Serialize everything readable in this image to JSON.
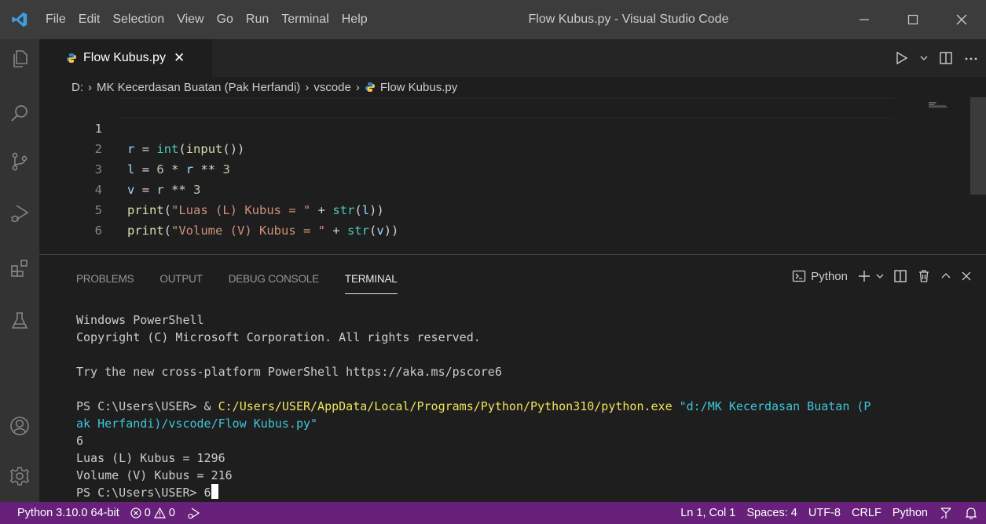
{
  "titlebar": {
    "menu": [
      "File",
      "Edit",
      "Selection",
      "View",
      "Go",
      "Run",
      "Terminal",
      "Help"
    ],
    "window_title": "Flow Kubus.py - Visual Studio Code"
  },
  "tab": {
    "label": "Flow Kubus.py",
    "close": "✕"
  },
  "breadcrumb": {
    "drive": "D:",
    "folder": "MK Kecerdasan Buatan (Pak Herfandi)",
    "subfolder": "vscode",
    "file": "Flow Kubus.py"
  },
  "editor": {
    "line_numbers": [
      "1",
      "2",
      "3",
      "4",
      "5",
      "6"
    ],
    "lines": [
      "r = int(input())",
      "l = 6 * r ** 3",
      "v = r ** 3",
      "print(\"Luas (L) Kubus = \" + str(l))",
      "print(\"Volume (V) Kubus = \" + str(v))",
      ""
    ]
  },
  "panel": {
    "tabs": [
      "PROBLEMS",
      "OUTPUT",
      "DEBUG CONSOLE",
      "TERMINAL"
    ],
    "active_tab": "TERMINAL",
    "terminal_name": "Python"
  },
  "terminal": {
    "l1": "Windows PowerShell",
    "l2": "Copyright (C) Microsoft Corporation. All rights reserved.",
    "l3": "Try the new cross-platform PowerShell https://aka.ms/pscore6",
    "prompt": "PS C:\\Users\\USER> & ",
    "python_exe": "C:/Users/USER/AppData/Local/Programs/Python/Python310/python.exe",
    "arg_part1": "\"d:/MK Kecerdasan Buatan (P",
    "arg_part2": "ak Herfandi)/vscode/Flow Kubus.py\"",
    "input": "6",
    "out1": "Luas (L) Kubus = 1296",
    "out2": "Volume (V) Kubus = 216",
    "last_prompt": "PS C:\\Users\\USER> 6"
  },
  "statusbar": {
    "interpreter": "Python 3.10.0 64-bit",
    "errors": "0",
    "warnings": "0",
    "position": "Ln 1, Col 1",
    "spaces": "Spaces: 4",
    "encoding": "UTF-8",
    "eol": "CRLF",
    "language": "Python"
  },
  "colors": {
    "statusbar": "#68217a",
    "titlebar": "#3c3c3c",
    "activitybar": "#333333",
    "editor_bg": "#1e1e1e"
  }
}
